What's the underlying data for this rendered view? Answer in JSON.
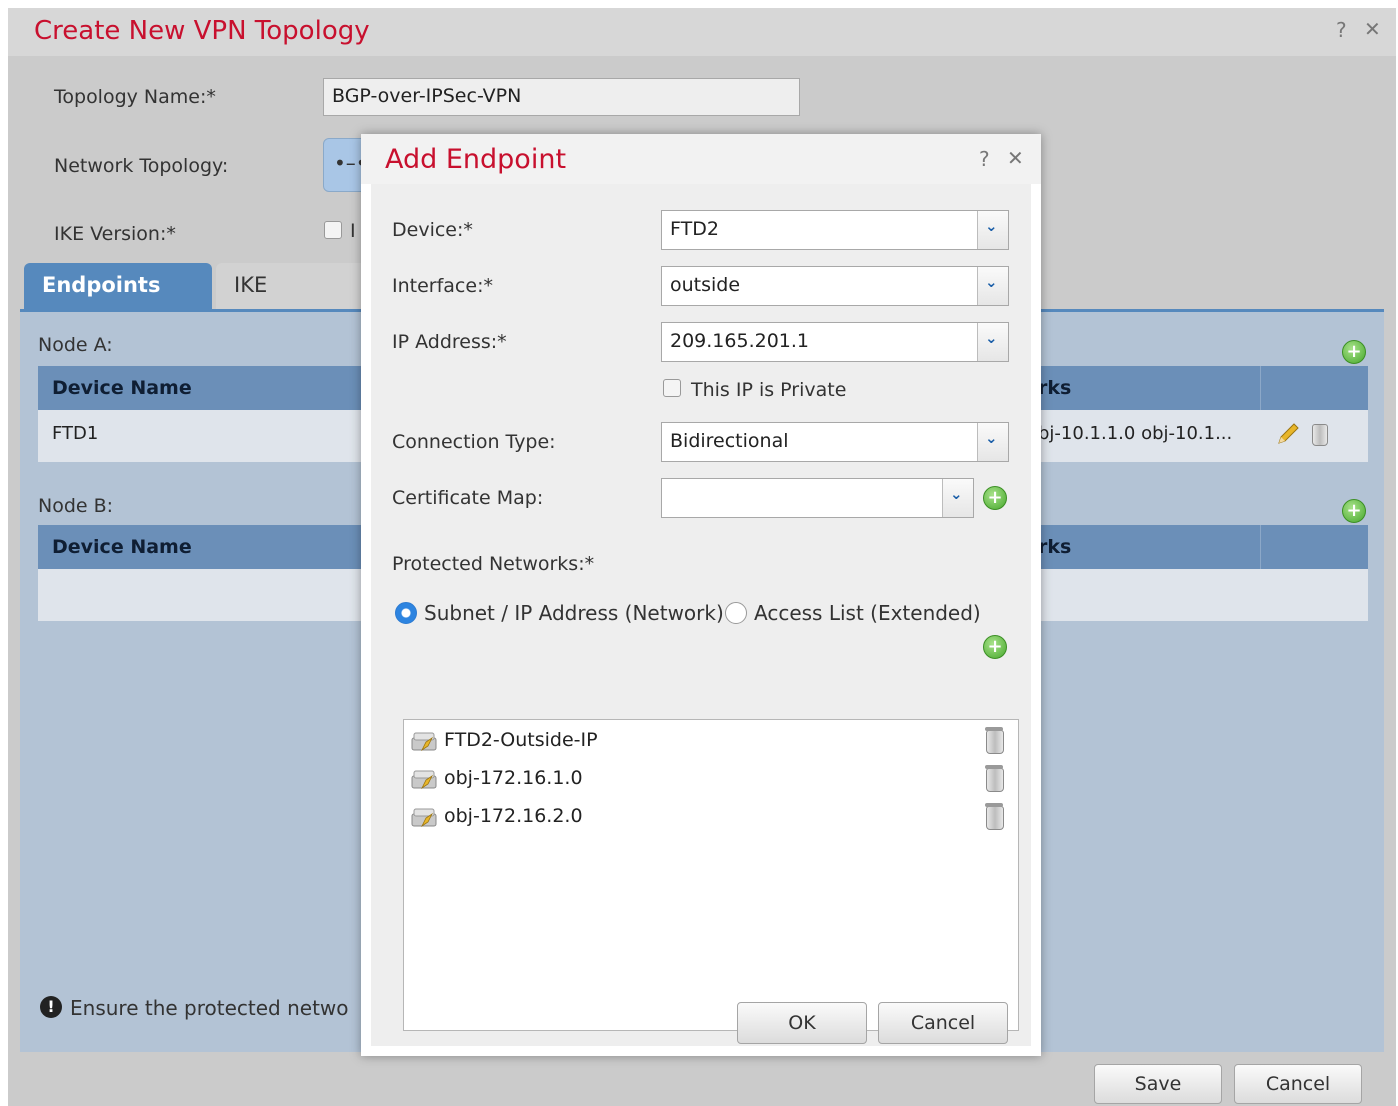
{
  "outer_dialog": {
    "title": "Create New VPN Topology",
    "help_glyph": "?",
    "close_glyph": "✕",
    "topology_name_label": "Topology Name:*",
    "topology_name_value": "BGP-over-IPSec-VPN",
    "network_topology_label": "Network Topology:",
    "ike_version_label": "IKE Version:*",
    "ike_visible_text": "I",
    "tabs": [
      {
        "label": "Endpoints",
        "active": true
      },
      {
        "label": "IKE",
        "active": false
      }
    ],
    "node_a_label": "Node A:",
    "node_b_label": "Node B:",
    "table_col_device_name": "Device Name",
    "table_col_networks_fragment": "rks",
    "node_a_rows": [
      {
        "device_name": "FTD1",
        "networks": "bj-10.1.1.0 obj-10.1..."
      }
    ],
    "footer_note": "Ensure the protected netwo",
    "save_label": "Save",
    "cancel_label": "Cancel"
  },
  "modal": {
    "title": "Add Endpoint",
    "help_glyph": "?",
    "close_glyph": "✕",
    "device_label": "Device:*",
    "device_value": "FTD2",
    "interface_label": "Interface:*",
    "interface_value": "outside",
    "ip_address_label": "IP Address:*",
    "ip_address_value": "209.165.201.1",
    "private_ip_label": "This IP is Private",
    "connection_type_label": "Connection Type:",
    "connection_type_value": "Bidirectional",
    "certificate_map_label": "Certificate Map:",
    "certificate_map_value": "",
    "protected_networks_label": "Protected Networks:*",
    "radio_subnet_label": "Subnet / IP Address (Network)",
    "radio_access_list_label": "Access List (Extended)",
    "protected_networks": [
      {
        "name": "FTD2-Outside-IP"
      },
      {
        "name": "obj-172.16.1.0"
      },
      {
        "name": "obj-172.16.2.0"
      }
    ],
    "ok_label": "OK",
    "cancel_label": "Cancel"
  },
  "colors": {
    "title_red": "#c8102e",
    "tab_active_blue": "#5689bd",
    "table_header_blue": "#6b8fb8",
    "panel_blue": "#b3c3d5"
  },
  "icons": {
    "add": "plus-circle-green",
    "delete": "trash-can",
    "edit": "pencil",
    "network_object": "network-object",
    "info": "exclamation-circle",
    "dropdown": "chevron-down"
  }
}
